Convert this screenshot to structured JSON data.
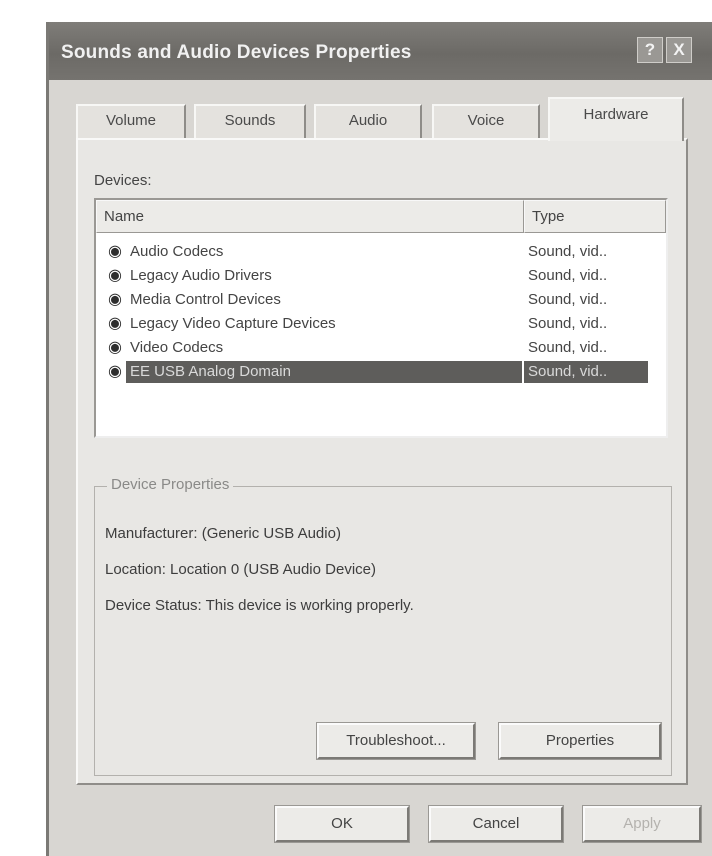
{
  "window": {
    "title": "Sounds and Audio Devices Properties",
    "help_button": "?",
    "close_button": "X"
  },
  "tabs": [
    {
      "label": "Volume"
    },
    {
      "label": "Sounds"
    },
    {
      "label": "Audio"
    },
    {
      "label": "Voice"
    },
    {
      "label": "Hardware",
      "active": true
    }
  ],
  "devices": {
    "label": "Devices:",
    "columns": {
      "name": "Name",
      "type": "Type"
    },
    "rows": [
      {
        "name": "Audio Codecs",
        "type": "Sound, vid..",
        "icon": "speaker-device-icon"
      },
      {
        "name": "Legacy Audio Drivers",
        "type": "Sound, vid..",
        "icon": "speaker-device-icon"
      },
      {
        "name": "Media Control Devices",
        "type": "Sound, vid..",
        "icon": "speaker-device-icon"
      },
      {
        "name": "Legacy Video Capture Devices",
        "type": "Sound, vid..",
        "icon": "speaker-device-icon"
      },
      {
        "name": "Video Codecs",
        "type": "Sound, vid..",
        "icon": "speaker-device-icon"
      },
      {
        "name": "EE USB Analog Domain",
        "type": "Sound, vid..",
        "icon": "speaker-device-icon",
        "selected": true
      }
    ]
  },
  "device_properties": {
    "title": "Device Properties",
    "manufacturer": "Manufacturer: (Generic USB Audio)",
    "location": "Location: Location 0 (USB Audio Device)",
    "status": "Device Status: This device is working properly."
  },
  "buttons": {
    "troubleshoot": "Troubleshoot...",
    "properties": "Properties",
    "ok": "OK",
    "cancel": "Cancel",
    "apply": "Apply"
  },
  "colors": {
    "selection": "#5e5d5b",
    "titlebar": "#74726e",
    "dialog_face": "#d8d6d2"
  }
}
